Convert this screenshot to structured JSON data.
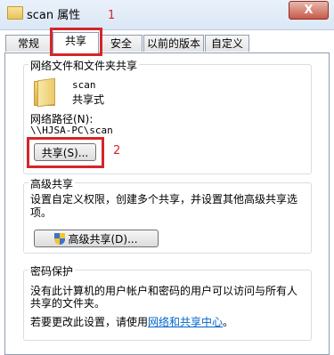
{
  "window": {
    "title": "scan 属性",
    "close_label": "X"
  },
  "tabs": [
    {
      "label": "常规"
    },
    {
      "label": "共享"
    },
    {
      "label": "安全"
    },
    {
      "label": "以前的版本"
    },
    {
      "label": "自定义"
    }
  ],
  "annotations": {
    "tab_marker": "1",
    "button_marker": "2",
    "color": "#d4262a"
  },
  "network_sharing": {
    "group_title": "网络文件和文件夹共享",
    "folder_name": "scan",
    "share_state": "共享式",
    "path_label": "网络路径(N):",
    "path_value": "\\\\HJSA-PC\\scan",
    "share_button": "共享(S)..."
  },
  "advanced_sharing": {
    "group_title": "高级共享",
    "description_line1": "设置自定义权限，创建多个共享，并设置其他高级共享选",
    "description_line2": "项。",
    "button": "高级共享(D)..."
  },
  "password_protection": {
    "group_title": "密码保护",
    "line1": "没有此计算机的用户帐户和密码的用户可以访问与所有人",
    "line2": "共享的文件夹。",
    "change_prefix": "若要更改此设置，请使用",
    "link": "网络和共享中心",
    "change_suffix": "。"
  }
}
